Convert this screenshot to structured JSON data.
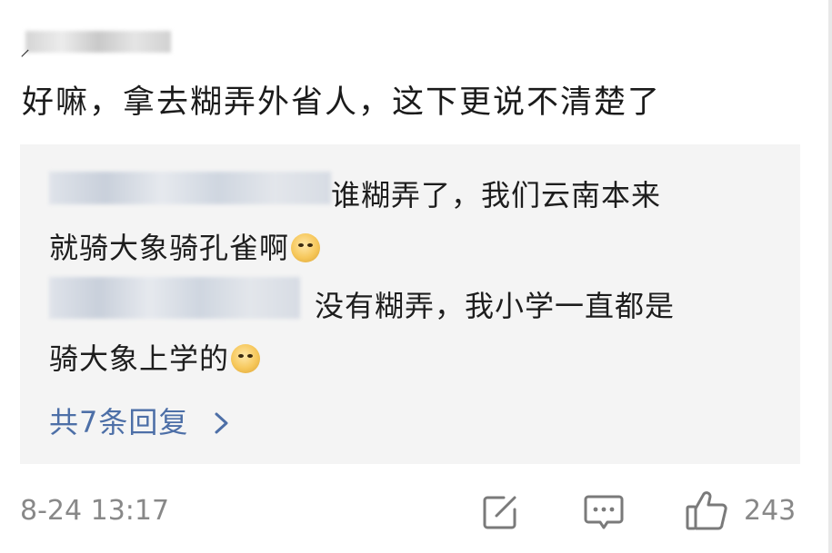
{
  "comment": {
    "author_mark": "⸝",
    "text": "好嘛，拿去糊弄外省人，这下更说不清楚了",
    "timestamp": "8-24 13:17",
    "like_count": "243"
  },
  "replies": [
    {
      "line1": "谁糊弄了，我们云南本来",
      "line2": "就骑大象骑孔雀啊",
      "emoji": "doge-emoji"
    },
    {
      "line1": "没有糊弄，我小学一直都是",
      "line2": "骑大象上学的",
      "emoji": "doge-emoji"
    }
  ],
  "more_replies": {
    "label": "共7条回复"
  },
  "colors": {
    "link": "#4d6fa7",
    "muted": "#888888",
    "reply_bg": "#f4f4f4"
  },
  "icons": [
    "edit-share-icon",
    "comment-bubble-icon",
    "thumbs-up-icon",
    "chevron-right-icon"
  ]
}
